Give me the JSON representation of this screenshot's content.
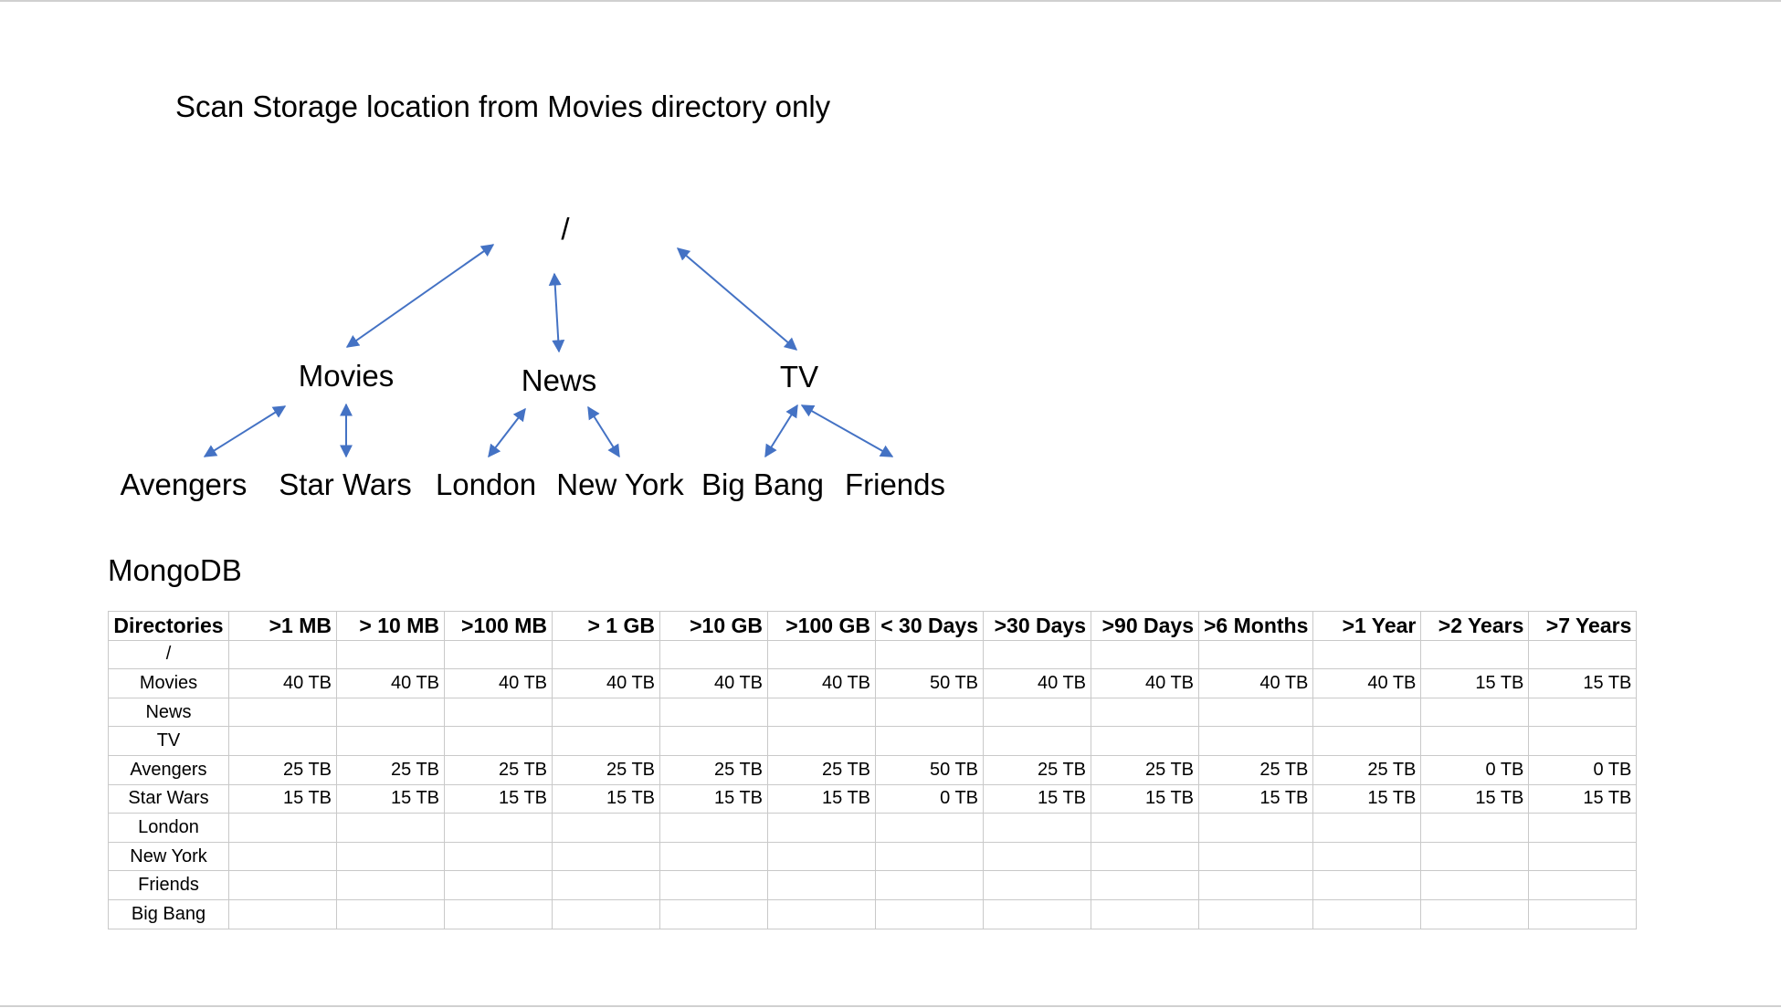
{
  "heading": "Scan Storage location from Movies  directory only",
  "tree": {
    "root": "/",
    "level1": [
      "Movies",
      "News",
      "TV"
    ],
    "level2": [
      "Avengers",
      "Star Wars",
      "London",
      "New York",
      "Big Bang",
      "Friends"
    ],
    "arrow_color": "#4472c4"
  },
  "db_title": "MongoDB",
  "table": {
    "headers": [
      "Directories",
      ">1 MB",
      "> 10 MB",
      ">100 MB",
      "> 1 GB",
      ">10 GB",
      ">100 GB",
      "< 30 Days",
      ">30 Days",
      ">90 Days",
      ">6 Months",
      ">1 Year",
      ">2 Years",
      ">7 Years"
    ],
    "rows": [
      [
        "/",
        "",
        "",
        "",
        "",
        "",
        "",
        "",
        "",
        "",
        "",
        "",
        "",
        ""
      ],
      [
        "Movies",
        "40 TB",
        "40 TB",
        "40 TB",
        "40 TB",
        "40 TB",
        "40 TB",
        "50 TB",
        "40 TB",
        "40 TB",
        "40 TB",
        "40 TB",
        "15 TB",
        "15 TB"
      ],
      [
        "News",
        "",
        "",
        "",
        "",
        "",
        "",
        "",
        "",
        "",
        "",
        "",
        "",
        ""
      ],
      [
        "TV",
        "",
        "",
        "",
        "",
        "",
        "",
        "",
        "",
        "",
        "",
        "",
        "",
        ""
      ],
      [
        "Avengers",
        "25 TB",
        "25 TB",
        "25 TB",
        "25 TB",
        "25 TB",
        "25 TB",
        "50 TB",
        "25 TB",
        "25 TB",
        "25 TB",
        "25 TB",
        "0 TB",
        "0 TB"
      ],
      [
        "Star Wars",
        "15 TB",
        "15 TB",
        "15 TB",
        "15 TB",
        "15 TB",
        "15 TB",
        "0 TB",
        "15 TB",
        "15 TB",
        "15 TB",
        "15 TB",
        "15 TB",
        "15 TB"
      ],
      [
        "London",
        "",
        "",
        "",
        "",
        "",
        "",
        "",
        "",
        "",
        "",
        "",
        "",
        ""
      ],
      [
        "New York",
        "",
        "",
        "",
        "",
        "",
        "",
        "",
        "",
        "",
        "",
        "",
        "",
        ""
      ],
      [
        "Friends",
        "",
        "",
        "",
        "",
        "",
        "",
        "",
        "",
        "",
        "",
        "",
        "",
        ""
      ],
      [
        "Big Bang",
        "",
        "",
        "",
        "",
        "",
        "",
        "",
        "",
        "",
        "",
        "",
        "",
        ""
      ]
    ]
  }
}
